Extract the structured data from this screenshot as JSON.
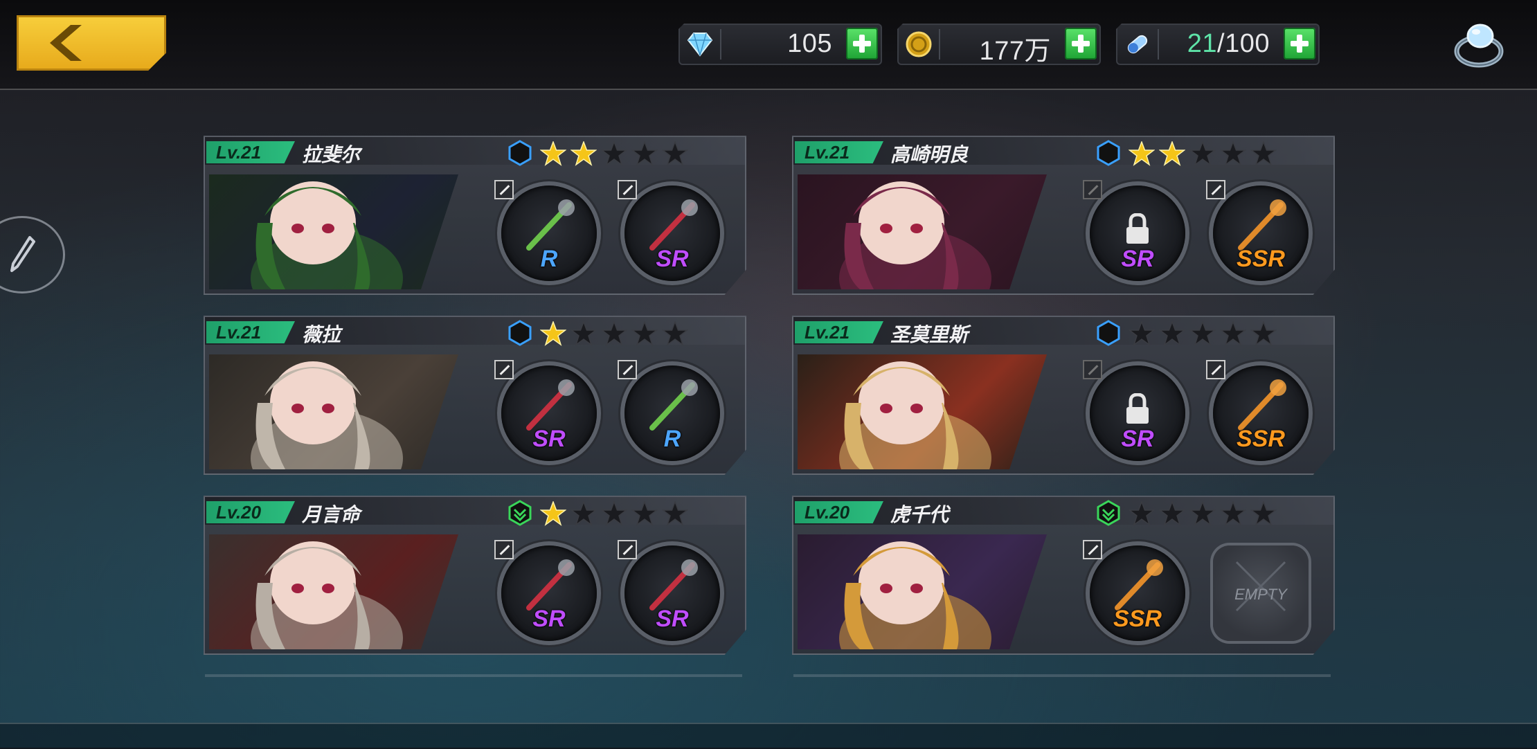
{
  "resources": [
    {
      "icon": "diamond-icon",
      "value": "105",
      "highlight": ""
    },
    {
      "icon": "gold-coin-icon",
      "value": "177万",
      "highlight": ""
    },
    {
      "icon": "stamina-capsule-icon",
      "value": "/100",
      "highlight": "21"
    }
  ],
  "cards": [
    {
      "level": "Lv.21",
      "name": "拉斐尔",
      "rank": "hexagon-rank-icon",
      "stars": 2,
      "slots": [
        {
          "rarity": "R",
          "cls": "r",
          "item": "flower-baton-icon"
        },
        {
          "rarity": "SR",
          "cls": "sr",
          "item": "thorn-ring-icon"
        }
      ],
      "portrait": "dark-haired-girl-green-coat"
    },
    {
      "level": "Lv.21",
      "name": "高崎明良",
      "rank": "hexagon-rank-icon",
      "stars": 2,
      "slots": [
        {
          "rarity": "SR",
          "cls": "sr",
          "item": "locked-slot-icon",
          "locked": true
        },
        {
          "rarity": "SSR",
          "cls": "ssr",
          "item": "guitar-icon"
        }
      ],
      "portrait": "twin-tail-girl-guitar"
    },
    {
      "level": "Lv.21",
      "name": "薇拉",
      "rank": "hexagon-rank-icon",
      "stars": 1,
      "slots": [
        {
          "rarity": "SR",
          "cls": "sr",
          "item": "death-box-icon"
        },
        {
          "rarity": "R",
          "cls": "r",
          "item": "flashlight-icon"
        }
      ],
      "portrait": "white-haired-girl-skull-clip"
    },
    {
      "level": "Lv.21",
      "name": "圣莫里斯",
      "rank": "hexagon-rank-icon",
      "stars": 0,
      "slots": [
        {
          "rarity": "SR",
          "cls": "sr",
          "item": "locked-slot-icon",
          "locked": true
        },
        {
          "rarity": "SSR",
          "cls": "ssr",
          "item": "ornate-shield-icon"
        }
      ],
      "portrait": "blonde-knight-girl"
    },
    {
      "level": "Lv.20",
      "name": "月言命",
      "rank": "chevron-rank-icon",
      "stars": 1,
      "slots": [
        {
          "rarity": "SR",
          "cls": "sr",
          "item": "scissors-blade-icon"
        },
        {
          "rarity": "SR",
          "cls": "sr",
          "item": "red-katana-icon"
        }
      ],
      "portrait": "silver-haired-girl-red-collar"
    },
    {
      "level": "Lv.20",
      "name": "虎千代",
      "rank": "chevron-rank-icon",
      "stars": 0,
      "slots": [
        {
          "rarity": "SSR",
          "cls": "ssr",
          "item": "katana-icon"
        },
        {
          "empty": true,
          "label": "EMPTY"
        }
      ],
      "portrait": "samurai-helmet-girl"
    }
  ],
  "colors": {
    "level_badge": "#2bbd7e",
    "star_on": "#f5c518",
    "star_off": "#1a1b1f",
    "rank_blue": "#3aa0ff",
    "rank_green": "#3ad65a"
  }
}
